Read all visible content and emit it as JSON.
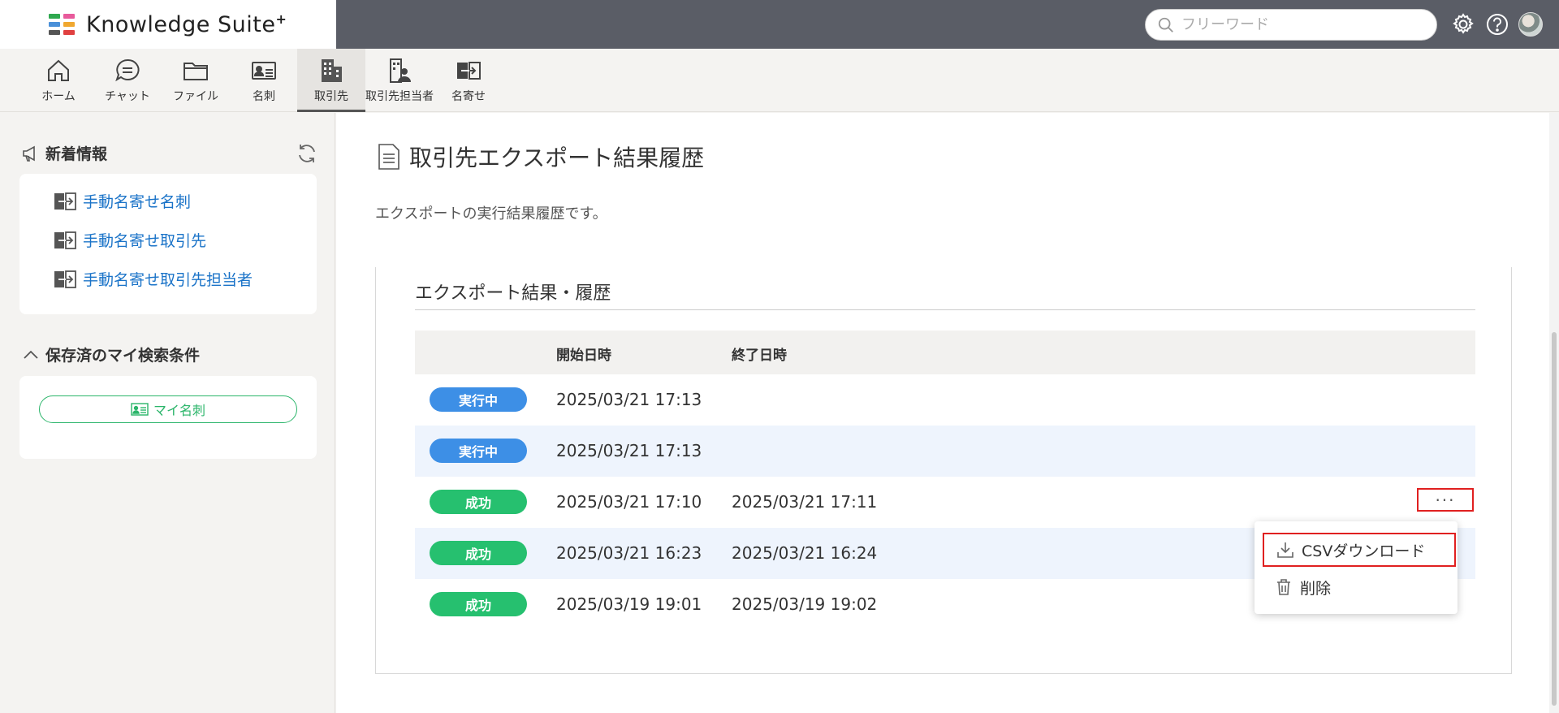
{
  "app": {
    "name": "Knowledge Suite",
    "sup": "+",
    "logo_colors": [
      "#2fa84f",
      "#e85a9b",
      "#4a90d9",
      "#f0a830",
      "#555555",
      "#e04040"
    ]
  },
  "header": {
    "search_placeholder": "フリーワード",
    "icons": [
      "gear-icon",
      "help-icon",
      "user-avatar"
    ]
  },
  "nav": {
    "items": [
      {
        "label": "ホーム",
        "icon": "home-icon"
      },
      {
        "label": "チャット",
        "icon": "chat-icon"
      },
      {
        "label": "ファイル",
        "icon": "folder-icon"
      },
      {
        "label": "名刺",
        "icon": "business-card-icon"
      },
      {
        "label": "取引先",
        "icon": "building-icon",
        "active": true
      },
      {
        "label": "取引先担当者",
        "icon": "contact-person-icon"
      },
      {
        "label": "名寄せ",
        "icon": "merge-icon"
      }
    ]
  },
  "sidebar": {
    "news_title": "新着情報",
    "news_links": [
      "手動名寄せ名刺",
      "手動名寄せ取引先",
      "手動名寄せ取引先担当者"
    ],
    "saved_title": "保存済のマイ検索条件",
    "saved_button": "マイ名刺"
  },
  "main": {
    "title": "取引先エクスポート結果履歴",
    "description": "エクスポートの実行結果履歴です。",
    "panel_title": "エクスポート結果・履歴",
    "columns": {
      "start": "開始日時",
      "end": "終了日時"
    },
    "rows": [
      {
        "status": "実行中",
        "status_type": "running",
        "start": "2025/03/21 17:13",
        "end": ""
      },
      {
        "status": "実行中",
        "status_type": "running",
        "start": "2025/03/21 17:13",
        "end": ""
      },
      {
        "status": "成功",
        "status_type": "success",
        "start": "2025/03/21 17:10",
        "end": "2025/03/21 17:11"
      },
      {
        "status": "成功",
        "status_type": "success",
        "start": "2025/03/21 16:23",
        "end": "2025/03/21 16:24"
      },
      {
        "status": "成功",
        "status_type": "success",
        "start": "2025/03/19 19:01",
        "end": "2025/03/19 19:02"
      }
    ],
    "more_label": "···"
  },
  "menu": {
    "items": [
      {
        "label": "CSVダウンロード",
        "icon": "download-icon"
      },
      {
        "label": "削除",
        "icon": "trash-icon"
      }
    ]
  },
  "colors": {
    "running": "#3d8fe6",
    "success": "#26c06f",
    "link": "#1a73c8",
    "highlight": "#e02020",
    "header": "#5a5d66"
  }
}
